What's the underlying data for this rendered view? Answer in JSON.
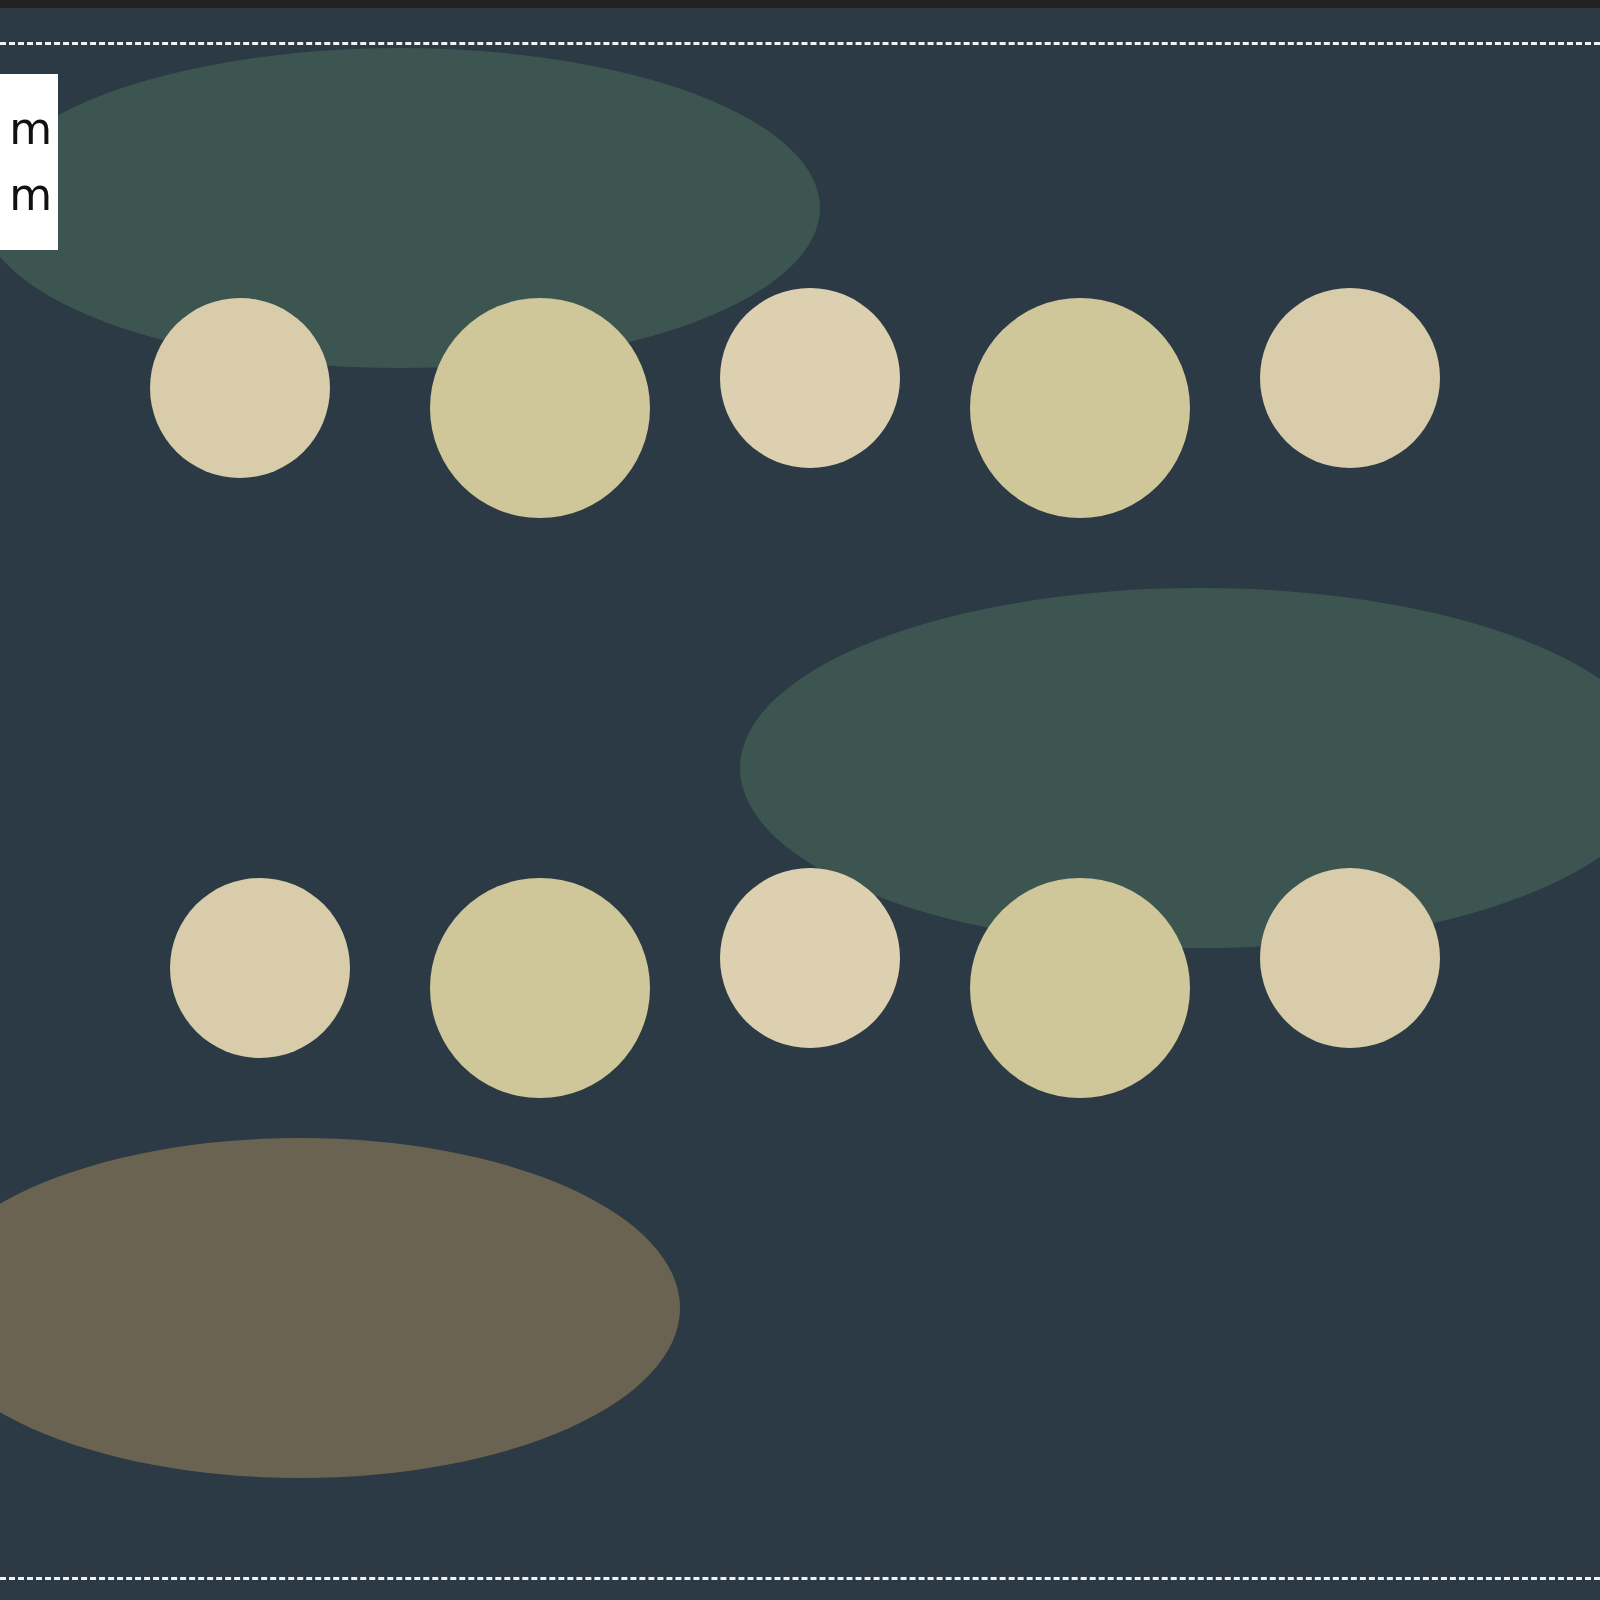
{
  "size_label": {
    "lines": [
      "m",
      "m"
    ]
  }
}
